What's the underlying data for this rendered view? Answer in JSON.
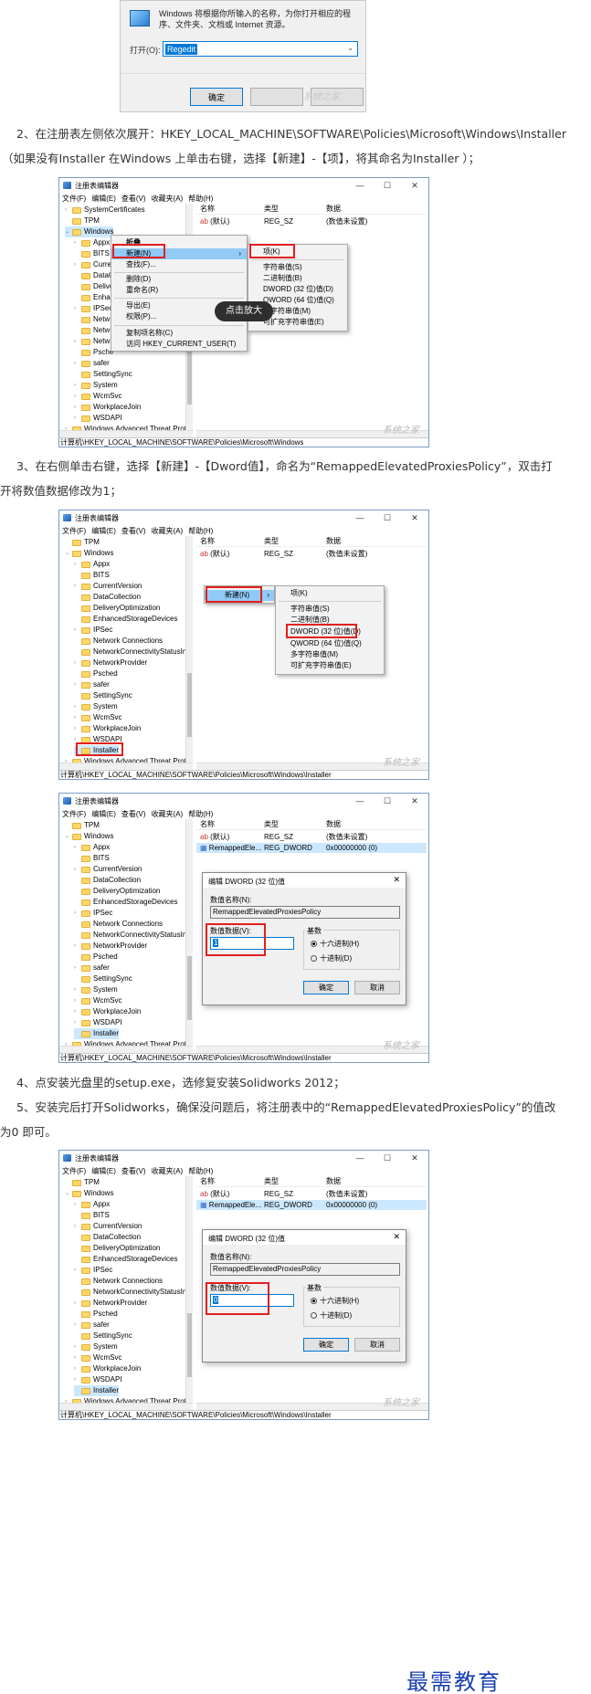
{
  "run_dialog": {
    "description": "Windows 将根据你所输入的名称，为你打开相应的程序、文件夹、文档或 Internet 资源。",
    "open_label": "打开(O):",
    "open_value": "Regedit",
    "ok": "确定",
    "watermark": "系统之家"
  },
  "step2": {
    "line1": "2、在注册表左侧依次展开：HKEY_LOCAL_MACHINE\\SOFTWARE\\Policies\\Microsoft\\Windows\\Installer",
    "line2": "（如果没有Installer 在Windows 上单击右键，选择【新建】-【项】，将其命名为Installer ）；"
  },
  "regedit": {
    "title": "注册表编辑器",
    "menu": [
      "文件(F)",
      "编辑(E)",
      "查看(V)",
      "收藏夹(A)",
      "帮助(H)"
    ],
    "col_name": "名称",
    "col_type": "类型",
    "col_data": "数据",
    "default_name": "(默认)",
    "default_type": "REG_SZ",
    "default_data": "(数值未设置)",
    "dword_name": "RemappedEle...",
    "dword_type": "REG_DWORD",
    "dword_data": "0x00000000 (0)",
    "min": "—",
    "max": "☐",
    "close": "✕",
    "watermark": "系统之家"
  },
  "shot1": {
    "tree": [
      "SystemCertificates",
      "TPM",
      "Windows",
      "Appx",
      "BITS",
      "Curre",
      "DataC",
      "Delive",
      "Enhar",
      "IPSec",
      "Netw",
      "Netw",
      "Netw",
      "Psche",
      "safer",
      "SettingSync",
      "System",
      "WcmSvc",
      "WorkplaceJoin",
      "WSDAPI",
      "Windows Advanced Threat Prote"
    ],
    "ctx": [
      "折叠",
      "新建(N)",
      "查找(F)...",
      "删除(D)",
      "重命名(R)",
      "导出(E)",
      "权限(P)...",
      "复制项名称(C)",
      "访问 HKEY_CURRENT_USER(T)"
    ],
    "submenu": [
      "项(K)",
      "字符串值(S)",
      "二进制值(B)",
      "DWORD (32 位)值(D)",
      "QWORD (64 位)值(Q)",
      "多字符串值(M)",
      "可扩充字符串值(E)"
    ],
    "tip": "点击放大",
    "status": "计算机\\HKEY_LOCAL_MACHINE\\SOFTWARE\\Policies\\Microsoft\\Windows"
  },
  "step3": {
    "line1": "3、在右侧单击右键，选择【新建】-【Dword值】，命名为“RemappedElevatedProxiesPolicy”，双击打",
    "line2": "开将数值数据修改为1；"
  },
  "tree_full": [
    "TPM",
    "Windows",
    "Appx",
    "BITS",
    "CurrentVersion",
    "DataCollection",
    "DeliveryOptimization",
    "EnhancedStorageDevices",
    "IPSec",
    "Network Connections",
    "NetworkConnectivityStatusInc",
    "NetworkProvider",
    "Psched",
    "safer",
    "SettingSync",
    "System",
    "WcmSvc",
    "WorkplaceJoin",
    "WSDAPI",
    "Installer",
    "Windows Advanced Threat Prote"
  ],
  "shot2": {
    "new_btn": "新建(N)",
    "submenu": [
      "项(K)",
      "字符串值(S)",
      "二进制值(B)",
      "DWORD (32 位)值(D)",
      "QWORD (64 位)值(Q)",
      "多字符串值(M)",
      "可扩充字符串值(E)"
    ],
    "status": "计算机\\HKEY_LOCAL_MACHINE\\SOFTWARE\\Policies\\Microsoft\\Windows\\Installer"
  },
  "dword_dialog": {
    "title": "编辑 DWORD (32 位)值",
    "name_label": "数值名称(N):",
    "name_value": "RemappedElevatedProxiesPolicy",
    "data_label": "数值数据(V):",
    "base_label": "基数",
    "hex": "十六进制(H)",
    "dec": "十进制(D)",
    "ok": "确定",
    "cancel": "取消",
    "value_shot3": "1",
    "value_shot4": "0"
  },
  "status_installer": "计算机\\HKEY_LOCAL_MACHINE\\SOFTWARE\\Policies\\Microsoft\\Windows\\Installer",
  "step4": "4、点安装光盘里的setup.exe，选修复安装Solidworks 2012；",
  "step5": {
    "line1": "5、安装完后打开Solidworks，确保没问题后，将注册表中的“RemappedElevatedProxiesPolicy”的值改",
    "line2": "为0 即可。"
  },
  "footer_brand": "最需教育"
}
